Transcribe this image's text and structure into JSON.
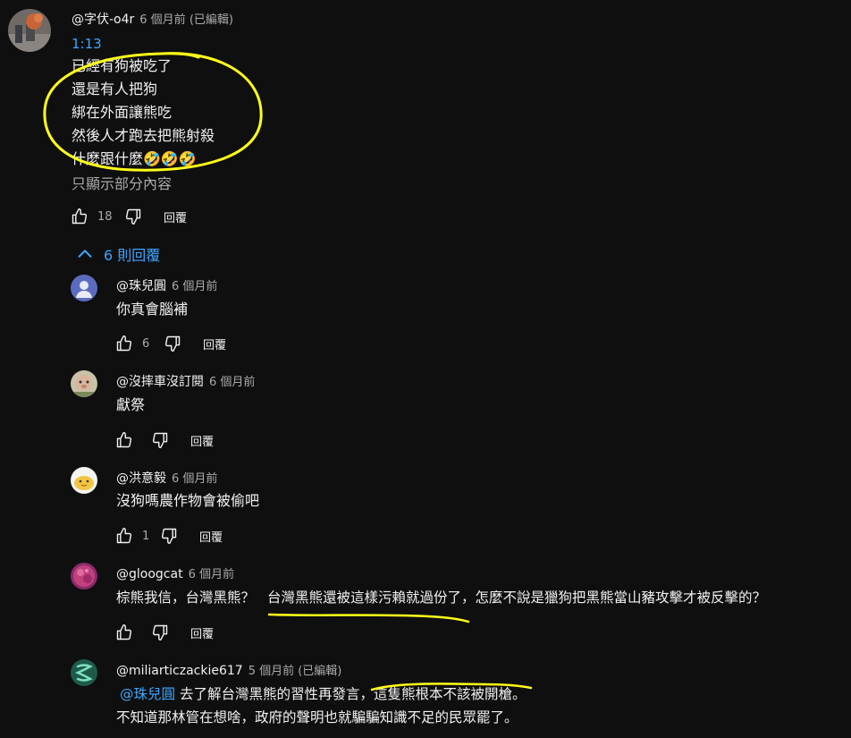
{
  "main_comment": {
    "handle": "@字伏-o4r",
    "time": "6 個月前 (已編輯)",
    "timestamp_link": "1:13",
    "lines": [
      "已經有狗被吃了",
      "還是有人把狗",
      "綁在外面讓熊吃",
      "然後人才跑去把熊射殺",
      "什麼跟什麼🤣🤣🤣"
    ],
    "show_partial": "只顯示部分內容",
    "likes": "18",
    "reply_label": "回覆"
  },
  "replies_toggle": {
    "label": "6 則回覆"
  },
  "replies": [
    {
      "handle": "@珠兒圓",
      "time": "6 個月前",
      "text": "你真會腦補",
      "likes": "6",
      "reply_label": "回覆"
    },
    {
      "handle": "@沒摔車沒訂閱",
      "time": "6 個月前",
      "text": "獻祭",
      "likes": "",
      "reply_label": "回覆"
    },
    {
      "handle": "@洪意毅",
      "time": "6 個月前",
      "text": "沒狗嗎農作物會被偷吧",
      "likes": "1",
      "reply_label": "回覆"
    },
    {
      "handle": "@gloogcat",
      "time": "6 個月前",
      "text_a": "棕熊我信，台灣黑熊？",
      "text_b": "台灣黑熊還被這樣污賴就過份了",
      "text_c": "，怎麼不說是獵狗把黑熊當山豬攻擊才被反擊的？",
      "likes": "",
      "reply_label": "回覆"
    },
    {
      "handle": "@miliarticzackie617",
      "time": "5 個月前 (已編輯)",
      "mention": "@珠兒圓",
      "line1_a": "去了解台灣黑熊的習性再發言，",
      "line1_b": "這隻熊根本不該被開槍",
      "line1_c": "。",
      "line2": "不知道那林管在想啥，政府的聲明也就騙騙知識不足的民眾罷了。"
    }
  ],
  "colors": {
    "background": "#0f0f0f",
    "link": "#3ea6ff",
    "annotation": "#ffff1a",
    "muted": "#aaaaaa"
  }
}
